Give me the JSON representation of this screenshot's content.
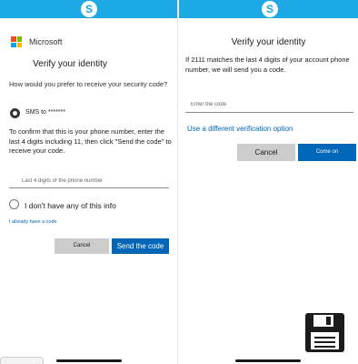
{
  "left_screen": {
    "brand": "Microsoft",
    "title": "Verify your identity",
    "prompt": "How would you prefer to receive your security code?",
    "sms_option": "SMS to *******",
    "confirm_text": "To confirm that this is your phone number, enter the last 4 digits including 11, then click \"Send the code\" to receive your code.",
    "last4_placeholder": "Last 4 digits of the phone number",
    "none_option": "I don't have any of this info",
    "already_have_code": "I already have a code",
    "cancel_label": "Cancel",
    "send_label": "Send the code"
  },
  "right_screen": {
    "title": "Verify your identity",
    "description": "If 2111 matches the last 4 digits of your account phone number, we will send you a code.",
    "code_placeholder": "Enter the code",
    "different_option": "Use a different verification option",
    "cancel_label": "Cancel",
    "confirm_label": "Come on"
  },
  "icons": {
    "app_logo": "skype-icon",
    "brand_logo": "microsoft-logo-icon",
    "overlay": "floppy-disk-save-icon"
  },
  "colors": {
    "topbar": "#1fa9e4",
    "primary_button": "#0067b8",
    "secondary_button": "#cccccc",
    "link": "#0067b8"
  }
}
